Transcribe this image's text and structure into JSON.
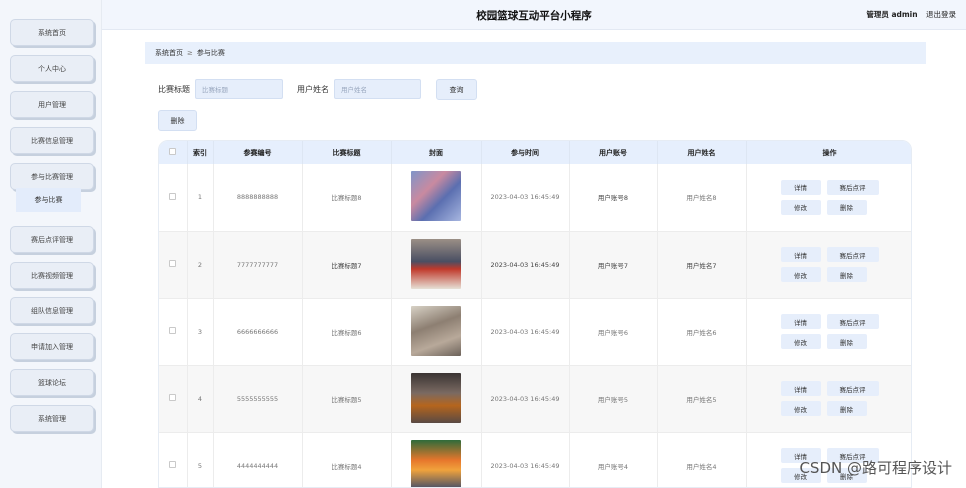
{
  "app_title": "校园篮球互动平台小程序",
  "user": {
    "role_label": "管理员 admin",
    "logout_label": "退出登录"
  },
  "sidebar": {
    "items": [
      {
        "label": "系统首页"
      },
      {
        "label": "个人中心"
      },
      {
        "label": "用户管理"
      },
      {
        "label": "比赛信息管理"
      },
      {
        "label": "参与比赛管理"
      },
      {
        "label": "赛后点评管理"
      },
      {
        "label": "比赛视频管理"
      },
      {
        "label": "组队信息管理"
      },
      {
        "label": "申请加入管理"
      },
      {
        "label": "篮球论坛"
      },
      {
        "label": "系统管理"
      }
    ],
    "active_submenu": "参与比赛"
  },
  "breadcrumb": {
    "home": "系统首页",
    "separator": "≥",
    "current": "参与比赛"
  },
  "search": {
    "title_label": "比赛标题",
    "title_placeholder": "比赛标题",
    "name_label": "用户姓名",
    "name_placeholder": "用户姓名",
    "query_label": "查询",
    "delete_label": "删除"
  },
  "table": {
    "columns": [
      "",
      "索引",
      "参赛编号",
      "比赛标题",
      "封面",
      "参与时间",
      "用户账号",
      "用户姓名",
      "操作"
    ],
    "rows": [
      {
        "index": "1",
        "number": "8888888888",
        "title": "比赛标题8",
        "time": "2023-04-03 16:45:49",
        "account": "用户账号8",
        "name": "用户姓名8"
      },
      {
        "index": "2",
        "number": "7777777777",
        "title": "比赛标题7",
        "time": "2023-04-03 16:45:49",
        "account": "用户账号7",
        "name": "用户姓名7"
      },
      {
        "index": "3",
        "number": "6666666666",
        "title": "比赛标题6",
        "time": "2023-04-03 16:45:49",
        "account": "用户账号6",
        "name": "用户姓名6"
      },
      {
        "index": "4",
        "number": "5555555555",
        "title": "比赛标题5",
        "time": "2023-04-03 16:45:49",
        "account": "用户账号5",
        "name": "用户姓名5"
      },
      {
        "index": "5",
        "number": "4444444444",
        "title": "比赛标题4",
        "time": "2023-04-03 16:45:49",
        "account": "用户账号4",
        "name": "用户姓名4"
      }
    ],
    "actions": {
      "detail": "详情",
      "review": "赛后点评",
      "edit": "修改",
      "delete": "删除"
    }
  },
  "watermark": "CSDN @路可程序设计",
  "colors": {
    "accent_bg": "#e6eefb",
    "header_bg": "#f2f6fd"
  }
}
